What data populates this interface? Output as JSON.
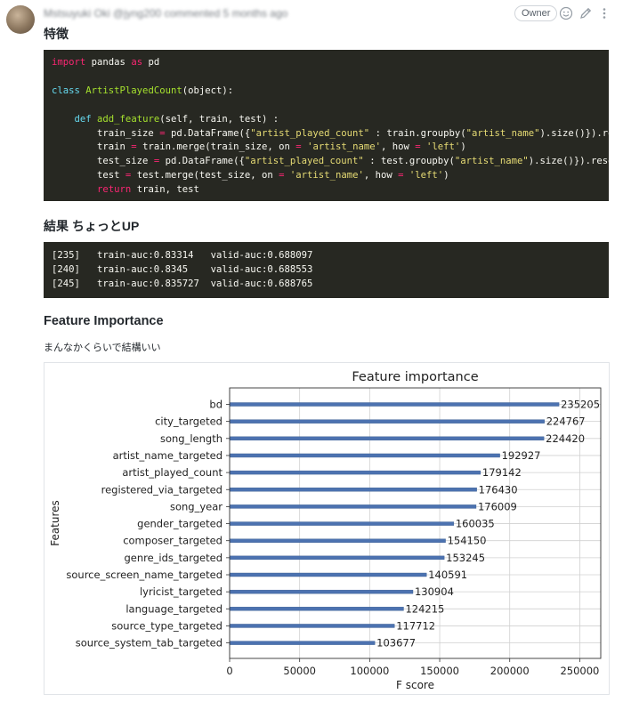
{
  "comment": {
    "author_line": "Mstsuyuki Oki @jyng200 commented 5 months ago",
    "badge": "Owner",
    "icons": [
      "smiley-icon",
      "pencil-icon",
      "kebab-icon"
    ]
  },
  "sections": {
    "features_heading": "特徴",
    "result_heading": "結果 ちょっとUP",
    "importance_heading": "Feature Importance",
    "importance_desc": "まんなかくらいで結構いい"
  },
  "code": {
    "lines": [
      "import pandas as pd",
      "",
      "class ArtistPlayedCount(object):",
      "",
      "    def add_feature(self, train, test) :",
      "        train_size = pd.DataFrame({\"artist_played_count\" : train.groupby(\"artist_name\").size()}).reset_index()",
      "        train = train.merge(train_size, on = 'artist_name', how = 'left')",
      "        test_size = pd.DataFrame({\"artist_played_count\" : test.groupby(\"artist_name\").size()}).reset_index()",
      "        test = test.merge(test_size, on = 'artist_name', how = 'left')",
      "        return train, test"
    ]
  },
  "results": {
    "lines": [
      "[235]   train-auc:0.83314   valid-auc:0.688097",
      "[240]   train-auc:0.8345    valid-auc:0.688553",
      "[245]   train-auc:0.835727  valid-auc:0.688765"
    ]
  },
  "chart_data": {
    "type": "bar",
    "orientation": "horizontal",
    "title": "Feature importance",
    "xlabel": "F score",
    "ylabel": "Features",
    "xlim": [
      0,
      265000
    ],
    "xticks": [
      0,
      50000,
      100000,
      150000,
      200000,
      250000
    ],
    "grid": true,
    "bar_color": "#4c72b0",
    "categories": [
      "bd",
      "city_targeted",
      "song_length",
      "artist_name_targeted",
      "artist_played_count",
      "registered_via_targeted",
      "song_year",
      "gender_targeted",
      "composer_targeted",
      "genre_ids_targeted",
      "source_screen_name_targeted",
      "lyricist_targeted",
      "language_targeted",
      "source_type_targeted",
      "source_system_tab_targeted"
    ],
    "values": [
      235205,
      224767,
      224420,
      192927,
      179142,
      176430,
      176009,
      160035,
      154150,
      153245,
      140591,
      130904,
      124215,
      117712,
      103677
    ]
  }
}
